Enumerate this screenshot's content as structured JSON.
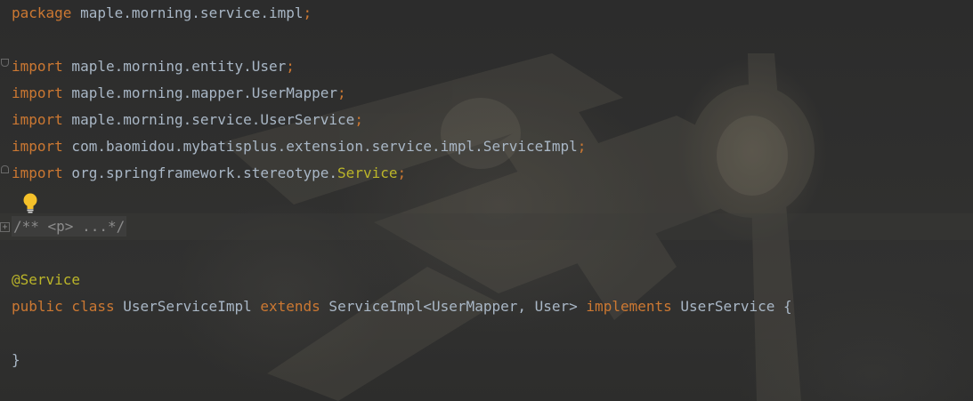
{
  "editor": {
    "theme_colors": {
      "background": "#2b2b2b",
      "keyword": "#cc7832",
      "annotation": "#bbb529",
      "comment": "#808080",
      "text": "#a9b7c6"
    },
    "lines": [
      {
        "segments": [
          {
            "t": "package",
            "c": "kw"
          },
          {
            "t": " maple.morning.service.impl",
            "c": "plain"
          },
          {
            "t": ";",
            "c": "kw"
          }
        ]
      },
      {
        "segments": []
      },
      {
        "segments": [
          {
            "t": "import",
            "c": "kw"
          },
          {
            "t": " maple.morning.entity.User",
            "c": "plain"
          },
          {
            "t": ";",
            "c": "kw"
          }
        ]
      },
      {
        "segments": [
          {
            "t": "import",
            "c": "kw"
          },
          {
            "t": " maple.morning.mapper.UserMapper",
            "c": "plain"
          },
          {
            "t": ";",
            "c": "kw"
          }
        ]
      },
      {
        "segments": [
          {
            "t": "import",
            "c": "kw"
          },
          {
            "t": " maple.morning.service.UserService",
            "c": "plain"
          },
          {
            "t": ";",
            "c": "kw"
          }
        ]
      },
      {
        "segments": [
          {
            "t": "import",
            "c": "kw"
          },
          {
            "t": " com.baomidou.mybatisplus.extension.service.impl.ServiceImpl",
            "c": "plain"
          },
          {
            "t": ";",
            "c": "kw"
          }
        ]
      },
      {
        "segments": [
          {
            "t": "import",
            "c": "kw"
          },
          {
            "t": " org.springframework.stereotype.",
            "c": "plain"
          },
          {
            "t": "Service",
            "c": "ann"
          },
          {
            "t": ";",
            "c": "kw"
          }
        ]
      },
      {
        "segments": []
      },
      {
        "segments": [
          {
            "t": "/** <p> ...*/",
            "c": "cmt folded"
          }
        ]
      },
      {
        "segments": []
      },
      {
        "segments": [
          {
            "t": "@Service",
            "c": "ann"
          }
        ]
      },
      {
        "segments": [
          {
            "t": "public class",
            "c": "kw"
          },
          {
            "t": " UserServiceImpl ",
            "c": "plain"
          },
          {
            "t": "extends",
            "c": "kw"
          },
          {
            "t": " ServiceImpl<UserMapper, User> ",
            "c": "plain"
          },
          {
            "t": "implements",
            "c": "kw"
          },
          {
            "t": " UserService {",
            "c": "plain"
          }
        ]
      },
      {
        "segments": []
      },
      {
        "segments": [
          {
            "t": "}",
            "c": "plain"
          }
        ]
      }
    ],
    "icons": {
      "intention_bulb": "lightbulb-icon",
      "fold_open": "fold-open-icon",
      "fold_close": "fold-close-icon",
      "fold_expand": "fold-expand-icon"
    }
  }
}
